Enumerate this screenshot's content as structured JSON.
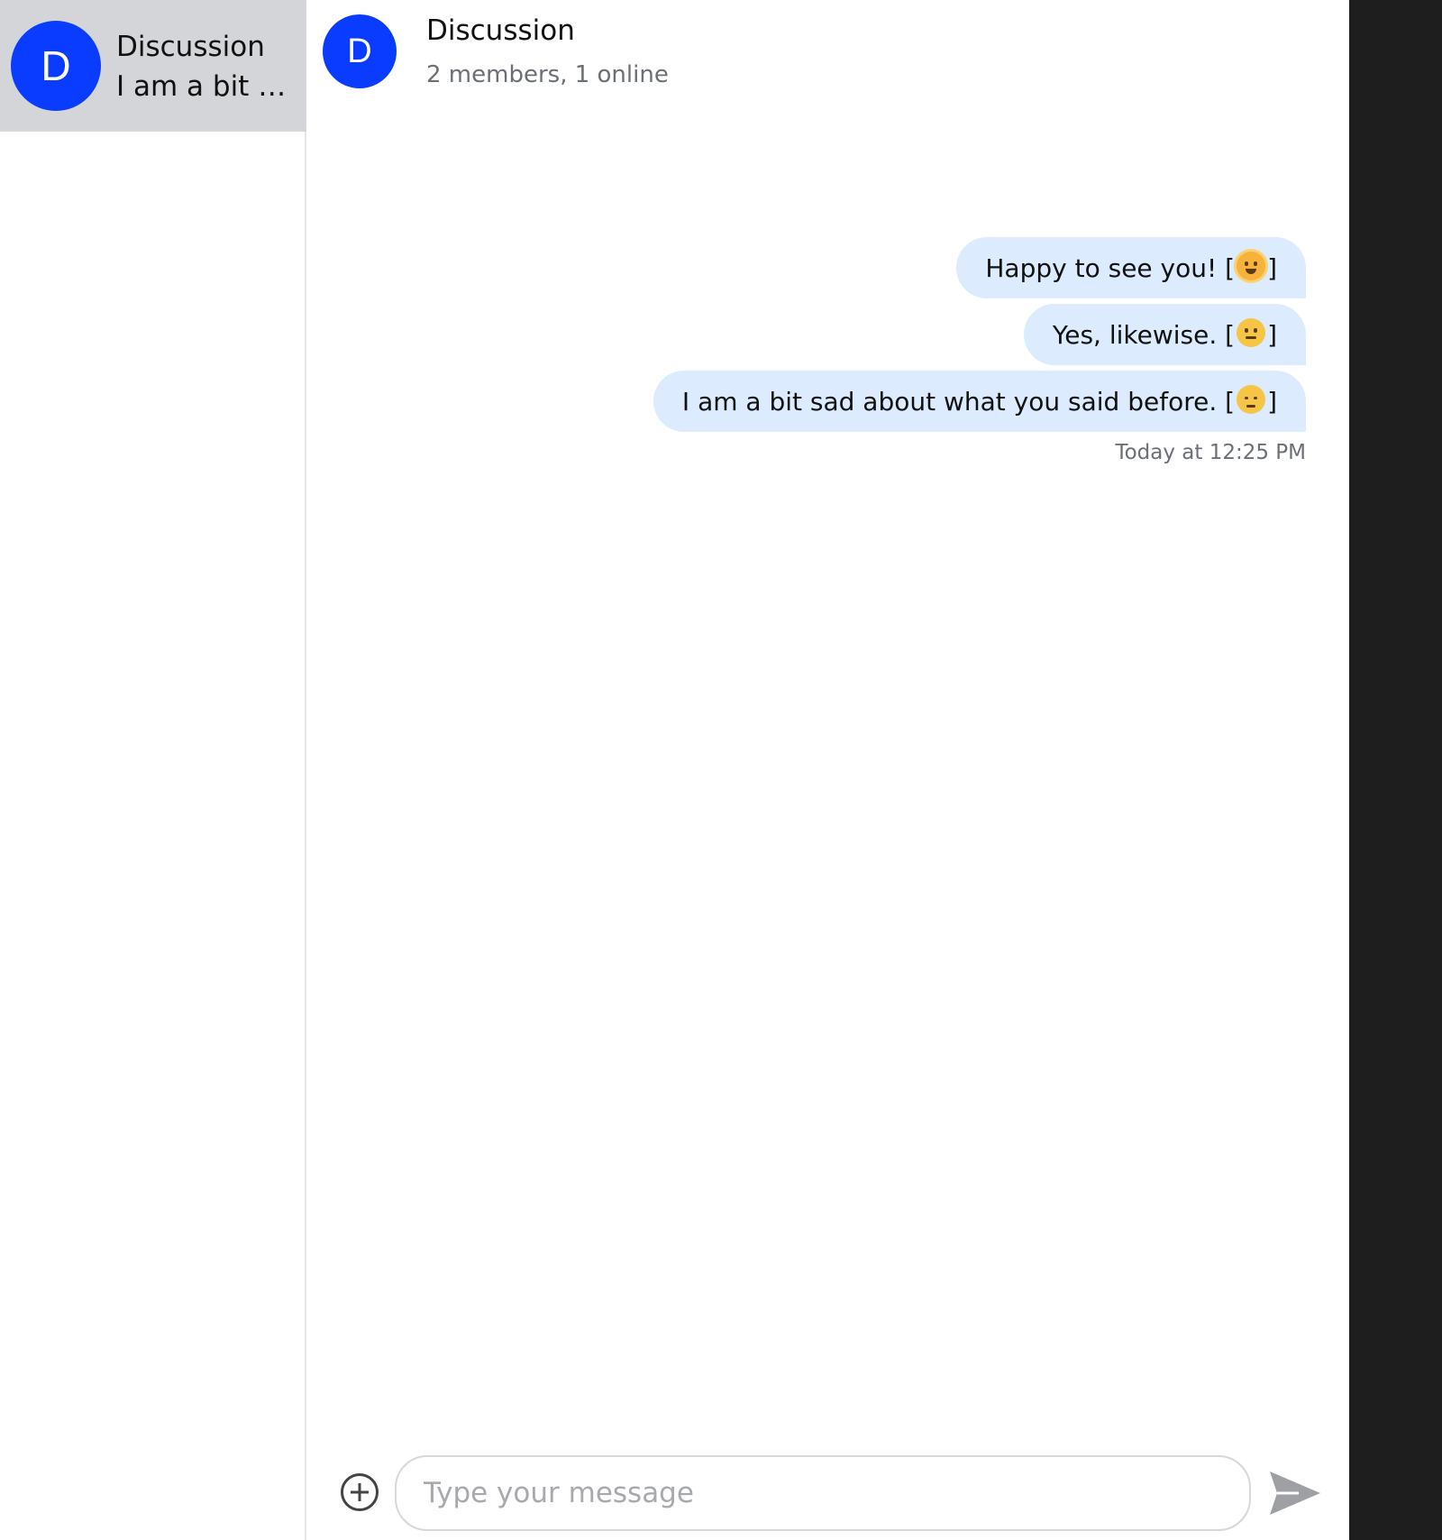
{
  "sidebar": {
    "conversations": [
      {
        "initial": "D",
        "title": "Discussion",
        "preview": "I am a bit s..."
      }
    ]
  },
  "chat": {
    "avatar_initial": "D",
    "title": "Discussion",
    "subtitle": "2 members, 1 online",
    "messages": [
      {
        "text": "Happy to see you! [",
        "emoji": "sun-face-icon",
        "suffix": "]"
      },
      {
        "text": "Yes, likewise. [",
        "emoji": "neutral-face-icon",
        "suffix": "]"
      },
      {
        "text": "I am a bit sad about what you said before. [",
        "emoji": "pensive-face-icon",
        "suffix": "]"
      }
    ],
    "timestamp": "Today at 12:25 PM"
  },
  "composer": {
    "placeholder": "Type your message",
    "value": ""
  },
  "colors": {
    "avatar": "#0a3cff",
    "bubble": "#dcebfd",
    "selected_conversation": "#d4d5d9",
    "dark_strip": "#1e1e1e"
  }
}
